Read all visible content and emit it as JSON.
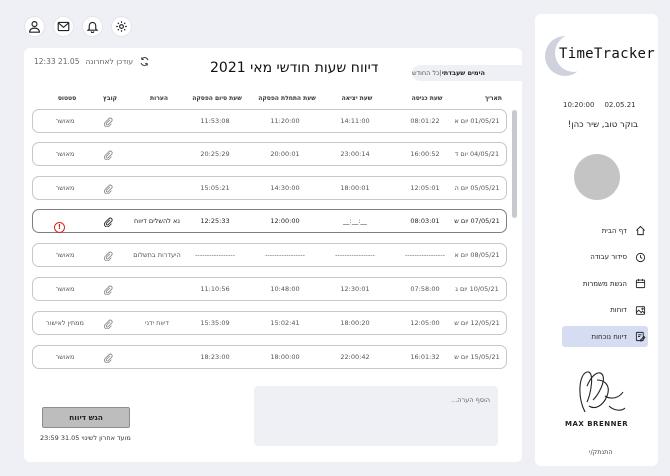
{
  "top_icons": [
    "user-icon",
    "mail-icon",
    "bell-icon",
    "gear-icon"
  ],
  "header": {
    "updated_label": "עודכן לאחרונה",
    "updated_value": "12:33 21.05",
    "title": "דיווח שעות חודשי מאי 2021",
    "view_bold": "הימים שעבדתי",
    "view_sep": " | ",
    "view_other": "כל החודש"
  },
  "table": {
    "columns": {
      "date": "תאריך",
      "in": "שעת כניסה",
      "out": "שעת יציאה",
      "break_start": "שעת התחלת הפסקה",
      "break_end": "שעת סיום הפסקה",
      "notes": "הערות",
      "file": "קובץ",
      "status": "סטטוס"
    },
    "rows": [
      {
        "date": "01/05/21 יום א",
        "in": "08:01:22",
        "out": "14:11:00",
        "break_start": "11:20:00",
        "break_end": "11:53:08",
        "notes": "",
        "status": "מאושר"
      },
      {
        "date": "04/05/21 יום ד",
        "in": "16:00:52",
        "out": "23:00:14",
        "break_start": "20:00:01",
        "break_end": "20:25:29",
        "notes": "",
        "status": "מאושר"
      },
      {
        "date": "05/05/21 יום ה",
        "in": "12:05:01",
        "out": "18:00:01",
        "break_start": "14:30:00",
        "break_end": "15:05:21",
        "notes": "",
        "status": "מאושר"
      },
      {
        "date": "07/05/21 יום ש",
        "in": "08:03:01",
        "out": "__:__:__",
        "break_start": "12:00:00",
        "break_end": "12:25:33",
        "notes": "נא להשלים דיווח",
        "status": "!"
      },
      {
        "date": "08/05/21 יום א",
        "in": "-----------------",
        "out": "-----------------",
        "break_start": "-----------------",
        "break_end": "-----------------",
        "notes": "היעדרות בתשלום",
        "status": "מאושר"
      },
      {
        "date": "10/05/21 יום ג",
        "in": "07:58:00",
        "out": "12:30:01",
        "break_start": "10:48:00",
        "break_end": "11:10:56",
        "notes": "",
        "status": "מאושר"
      },
      {
        "date": "12/05/21 יום ש",
        "in": "12:05:00",
        "out": "18:00:20",
        "break_start": "15:02:41",
        "break_end": "15:35:09",
        "notes": "דיווח ידני",
        "status": "ממתין לאישור"
      },
      {
        "date": "15/05/21 יום ש",
        "in": "16:01:32",
        "out": "22:00:42",
        "break_start": "18:00:00",
        "break_end": "18:23:00",
        "notes": "",
        "status": "מאושר"
      }
    ]
  },
  "note_placeholder": "הוסף הערה...",
  "submit_label": "הגש דיווח",
  "deadline": "מועד אחרון לשינוי 31.05 23:59",
  "sidebar": {
    "logo_text": "TimeTracker",
    "date": "02.05.21",
    "time": "10:20:00",
    "greeting": "בוקר טוב, שיר כהן!",
    "nav": [
      {
        "label": "דף הבית",
        "icon": "home-icon"
      },
      {
        "label": "סידור עבודה",
        "icon": "clock-icon"
      },
      {
        "label": "הגשת משמרות",
        "icon": "calendar-icon"
      },
      {
        "label": "דוחות",
        "icon": "image-icon"
      },
      {
        "label": "דיווח נוכחות",
        "icon": "edit-icon"
      }
    ],
    "signature_name": "MAX BRENNER",
    "logout": "התנתק/י"
  }
}
